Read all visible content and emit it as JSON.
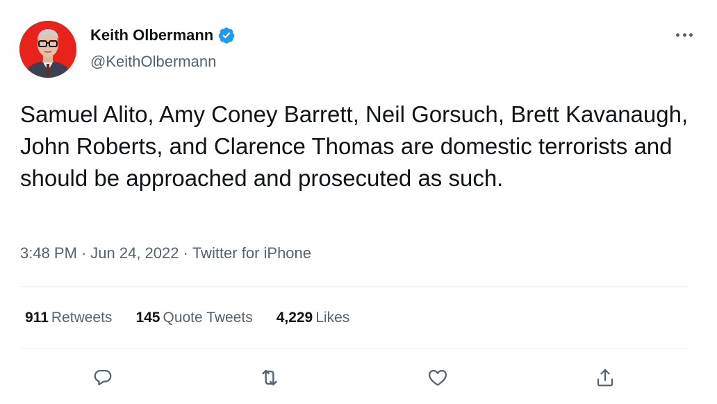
{
  "author": {
    "name": "Keith Olbermann",
    "handle": "@KeithOlbermann",
    "verified": true
  },
  "tweet": {
    "text": "Samuel Alito, Amy Coney Barrett, Neil Gorsuch, Brett Kavanaugh, John Roberts, and Clarence Thomas are domestic terrorists and should be approached and prosecuted as such.",
    "time": "3:48 PM",
    "date": "Jun 24, 2022",
    "source": "Twitter for iPhone",
    "separator": "·"
  },
  "stats": {
    "retweets": {
      "count": "911",
      "label": "Retweets"
    },
    "quote_tweets": {
      "count": "145",
      "label": "Quote Tweets"
    },
    "likes": {
      "count": "4,229",
      "label": "Likes"
    }
  },
  "icons": {
    "verified": "verified-badge-icon",
    "more": "more-icon",
    "reply": "reply-icon",
    "retweet": "retweet-icon",
    "like": "heart-icon",
    "share": "share-icon"
  },
  "colors": {
    "text_primary": "#0f1419",
    "text_secondary": "#536471",
    "verified": "#1d9bf0",
    "divider": "#eff3f4",
    "avatar_bg": "#e8231c"
  }
}
